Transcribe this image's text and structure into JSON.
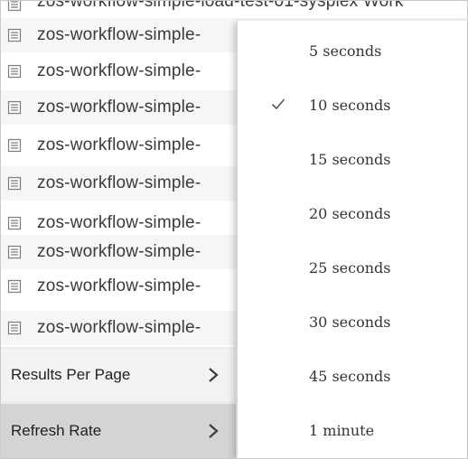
{
  "list": {
    "truncated_top_row": "zos-workflow-simple-load-test-01-sysplex  Work",
    "rows": [
      "zos-workflow-simple-",
      "zos-workflow-simple-",
      "zos-workflow-simple-",
      "zos-workflow-simple-",
      "zos-workflow-simple-",
      "zos-workflow-simple-",
      "zos-workflow-simple-",
      "zos-workflow-simple-"
    ],
    "row_icon": "document-icon"
  },
  "submenu": {
    "items": [
      {
        "label": "Results Per Page",
        "icon": "chevron-right-icon",
        "active": false
      },
      {
        "label": "Refresh Rate",
        "icon": "chevron-right-icon",
        "active": true
      }
    ]
  },
  "refresh_rate": {
    "options": [
      {
        "label": "5 seconds",
        "selected": false
      },
      {
        "label": "10 seconds",
        "selected": true
      },
      {
        "label": "15 seconds",
        "selected": false
      },
      {
        "label": "20 seconds",
        "selected": false
      },
      {
        "label": "25 seconds",
        "selected": false
      },
      {
        "label": "30 seconds",
        "selected": false
      },
      {
        "label": "45 seconds",
        "selected": false
      },
      {
        "label": "1 minute",
        "selected": false
      }
    ],
    "check_icon": "checkmark-icon"
  },
  "colors": {
    "menu_background": "#ececec",
    "active_item_background": "#d4d4d4",
    "text": "#333333"
  }
}
